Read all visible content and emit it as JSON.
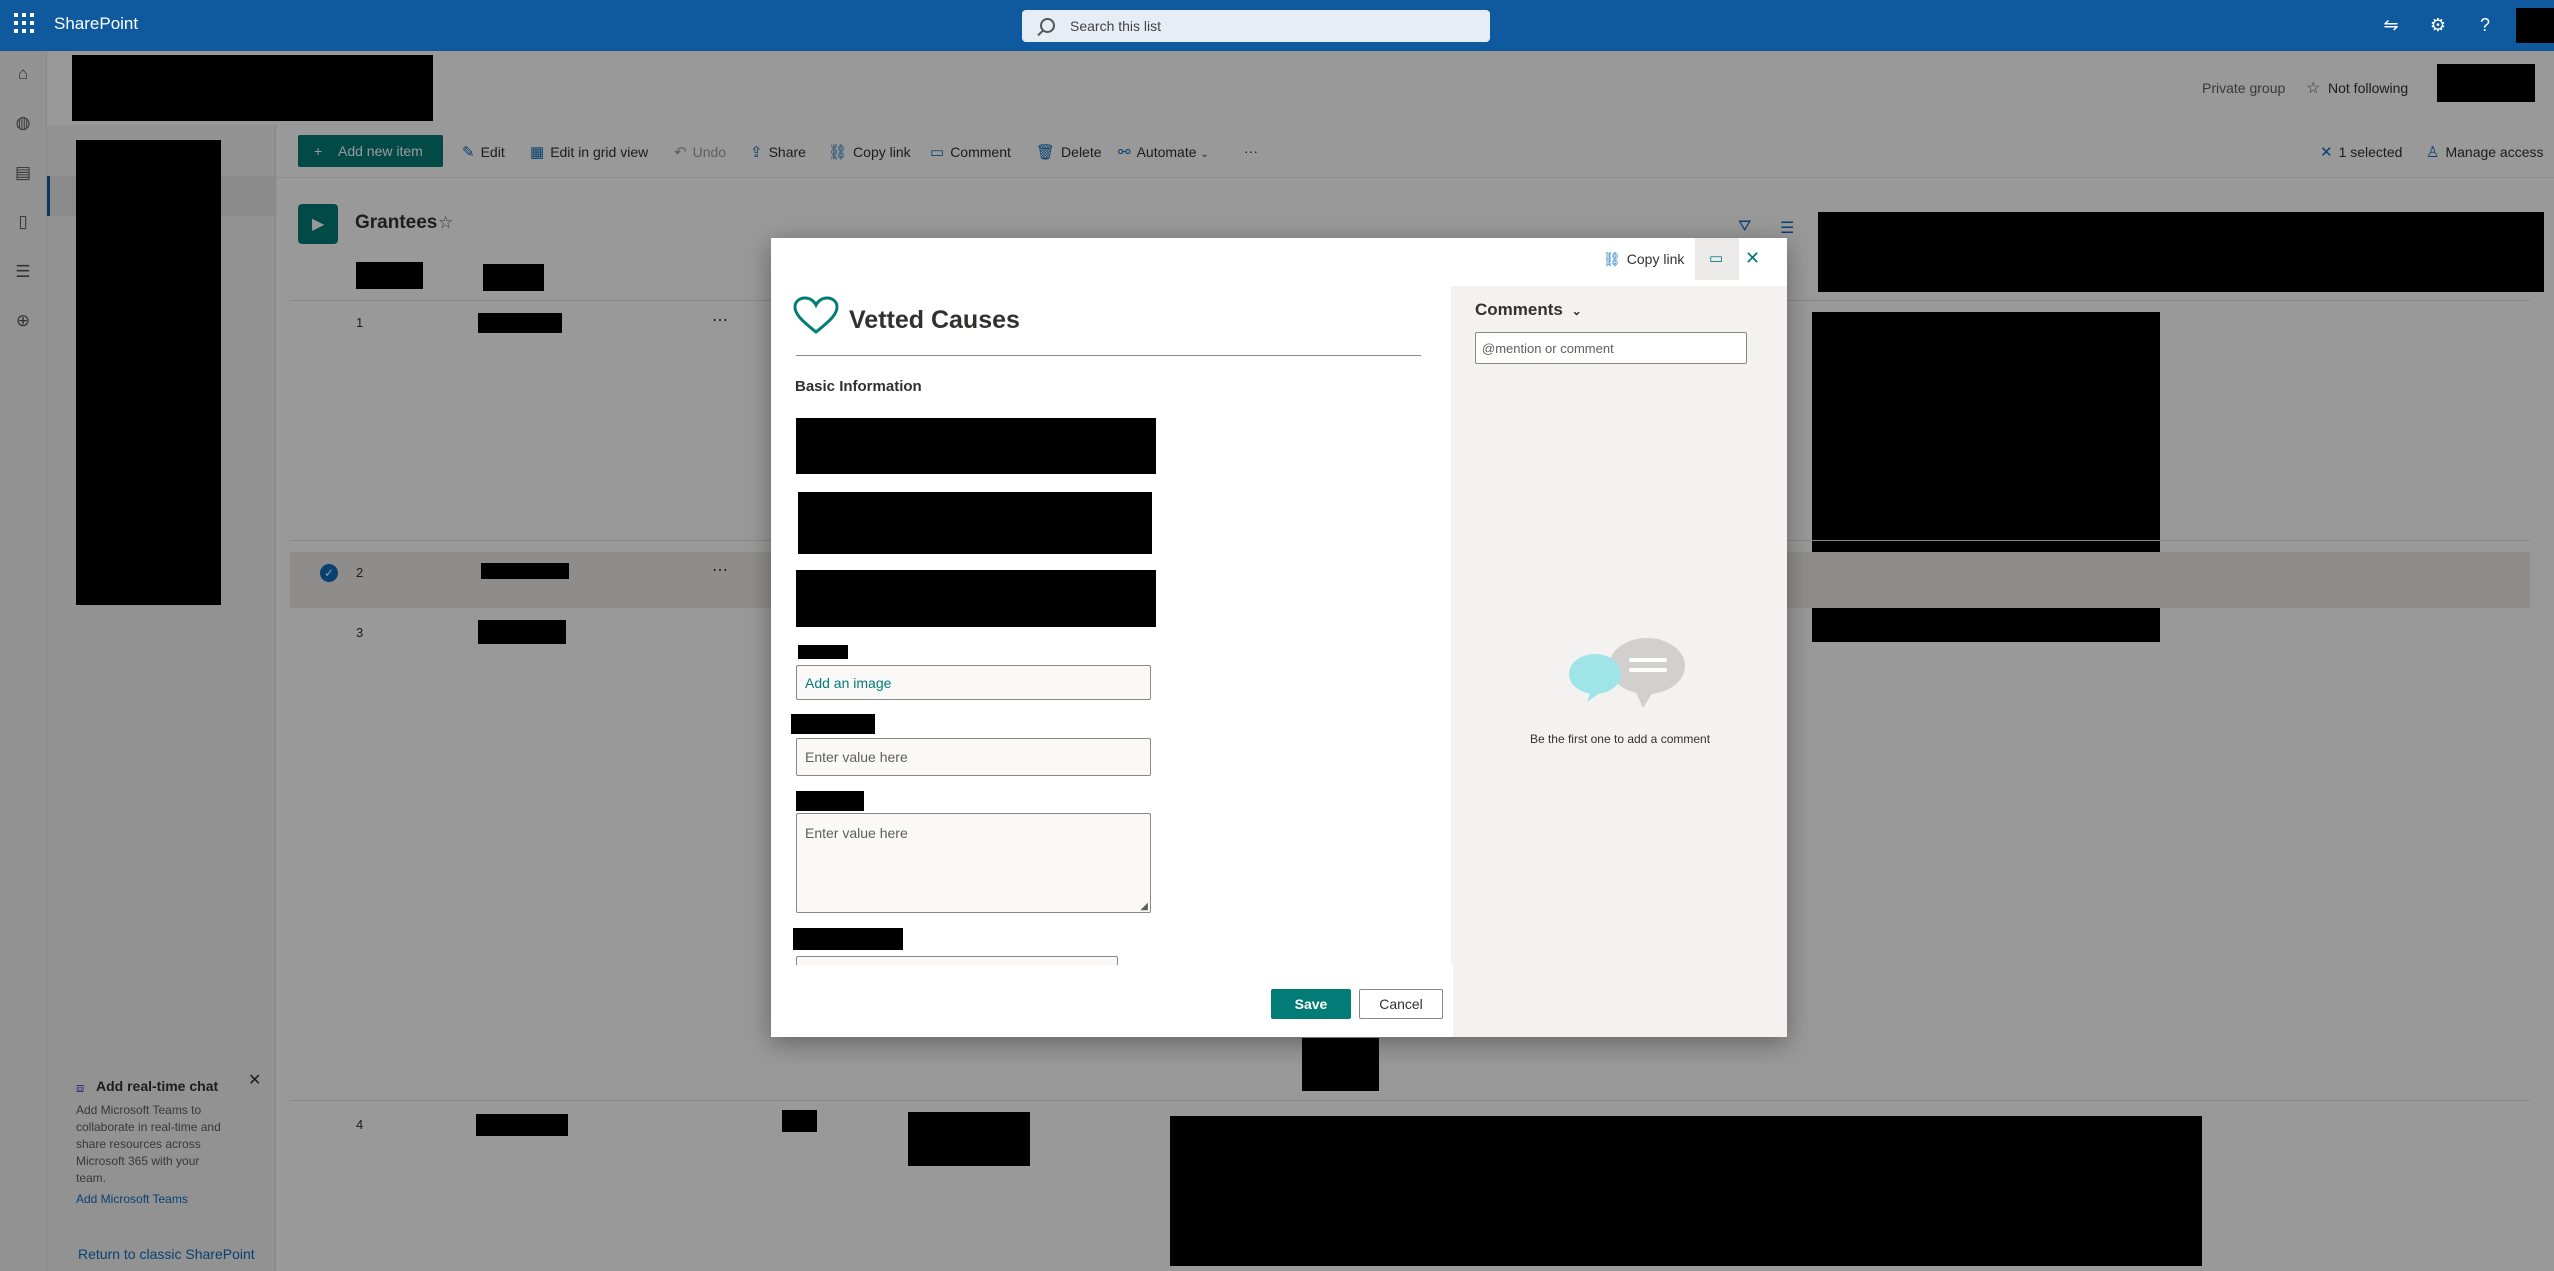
{
  "suite_bar": {
    "app_name": "SharePoint",
    "search_placeholder": "Search this list",
    "icons": [
      "waffle-icon",
      "sync-icon",
      "gear-icon",
      "help-icon"
    ]
  },
  "site_header": {
    "privacy": "Private group",
    "follow_label": "Not following"
  },
  "command_bar": {
    "add_new_item": "Add new item",
    "edit": "Edit",
    "edit_grid": "Edit in grid view",
    "undo": "Undo",
    "share": "Share",
    "copy_link": "Copy link",
    "comment": "Comment",
    "delete": "Delete",
    "automate": "Automate",
    "more": "···",
    "selected_count": "1 selected",
    "manage_access": "Manage access"
  },
  "list": {
    "title": "Grantees",
    "rows": [
      {
        "num": "1"
      },
      {
        "num": "2"
      },
      {
        "num": "3"
      },
      {
        "num": "4"
      }
    ]
  },
  "chat_promo": {
    "title": "Add real-time chat",
    "body": "Add Microsoft Teams to collaborate in real-time and share resources across Microsoft 365 with your team.",
    "link": "Add Microsoft Teams"
  },
  "return_classic": "Return to classic SharePoint",
  "dialog": {
    "copy_link": "Copy link",
    "form_title": "Vetted Causes",
    "section": "Basic Information",
    "add_image": "Add an image",
    "value_placeholder_1": "Enter value here",
    "value_placeholder_2": "Enter value here",
    "save": "Save",
    "cancel": "Cancel",
    "comments": {
      "header": "Comments",
      "input_placeholder": "@mention or comment",
      "empty": "Be the first one to add a comment"
    }
  },
  "colors": {
    "suite_bar": "#0f5a9e",
    "accent": "#037c78",
    "overlay": "rgba(0,0,0,0.4)"
  }
}
